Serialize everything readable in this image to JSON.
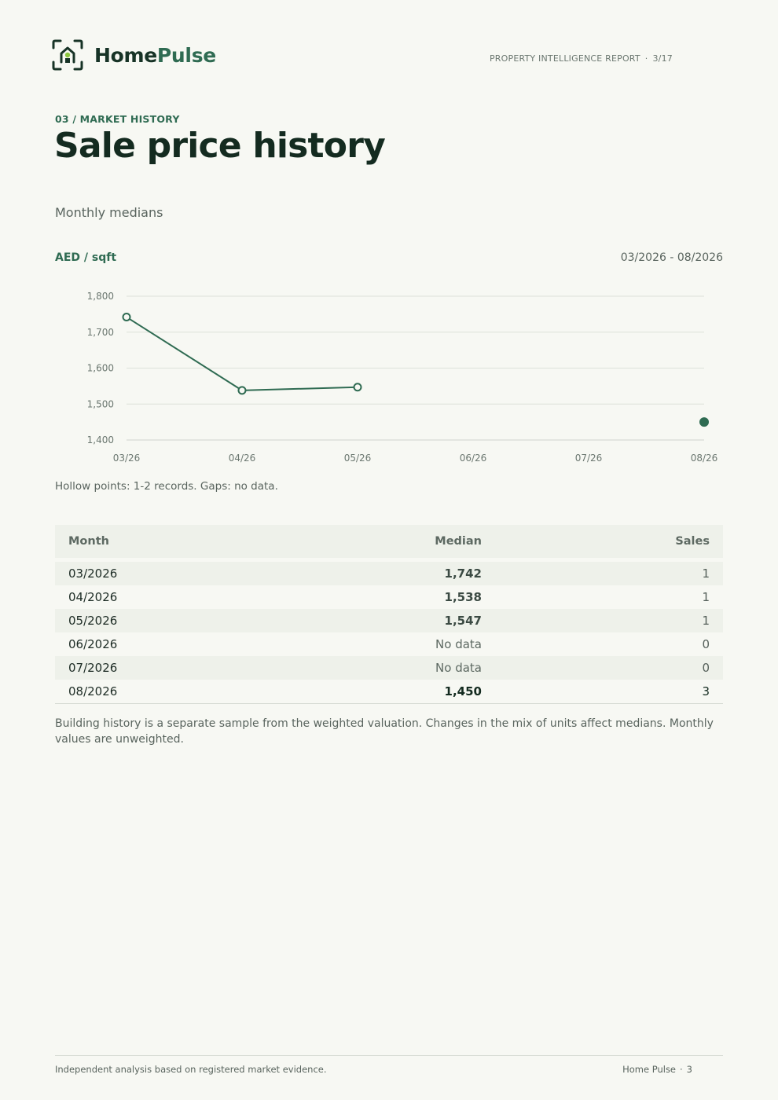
{
  "brand": {
    "name_part1": "Home",
    "name_part2": "Pulse"
  },
  "header": {
    "report_label": "PROPERTY INTELLIGENCE REPORT",
    "separator": "·",
    "page_of": "3/17"
  },
  "section": {
    "tag": "03 / MARKET HISTORY",
    "title": "Sale price history",
    "subtitle": "Monthly medians"
  },
  "chart_meta": {
    "unit": "AED / sqft",
    "range": "03/2026 - 08/2026",
    "note": "Hollow points: 1-2 records. Gaps: no data."
  },
  "chart_data": {
    "type": "line",
    "title": "",
    "xlabel": "",
    "ylabel": "AED / sqft",
    "categories": [
      "03/26",
      "04/26",
      "05/26",
      "06/26",
      "07/26",
      "08/26"
    ],
    "series": [
      {
        "values": [
          1742,
          1538,
          1547,
          null,
          null,
          1450
        ],
        "sales": [
          1,
          1,
          1,
          0,
          0,
          3
        ]
      }
    ],
    "ylim": [
      1400,
      1800
    ],
    "yticks": [
      1400,
      1500,
      1600,
      1700,
      1800
    ],
    "ytick_labels": [
      "1,400",
      "1,500",
      "1,600",
      "1,700",
      "1,800"
    ],
    "grid": true,
    "color": "#2f6b52"
  },
  "table": {
    "headers": {
      "month": "Month",
      "median": "Median",
      "sales": "Sales"
    },
    "rows": [
      {
        "month": "03/2026",
        "median": "1,742",
        "sales": "1"
      },
      {
        "month": "04/2026",
        "median": "1,538",
        "sales": "1"
      },
      {
        "month": "05/2026",
        "median": "1,547",
        "sales": "1"
      },
      {
        "month": "06/2026",
        "median": "No data",
        "sales": "0"
      },
      {
        "month": "07/2026",
        "median": "No data",
        "sales": "0"
      },
      {
        "month": "08/2026",
        "median": "1,450",
        "sales": "3"
      }
    ]
  },
  "footnote": "Building history is a separate sample from the weighted valuation. Changes in the mix of units affect medians. Monthly values are unweighted.",
  "footer": {
    "left": "Independent analysis based on registered market evidence.",
    "brand": "Home Pulse",
    "separator": "·",
    "page": "3"
  }
}
